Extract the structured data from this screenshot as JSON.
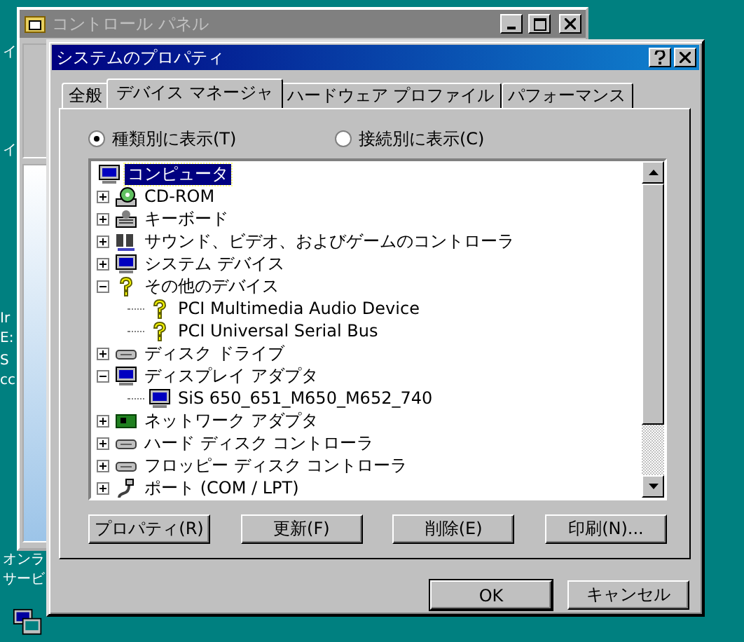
{
  "desktop_labels": [
    "イ",
    "イ",
    "Ir",
    "E:",
    "S",
    "cc",
    "オンラ",
    "サービ"
  ],
  "background_window": {
    "title": "コントロール パネル"
  },
  "dialog": {
    "title": "システムのプロパティ"
  },
  "tabs": [
    {
      "label": "全般",
      "selected": false
    },
    {
      "label": "デバイス マネージャ",
      "selected": true
    },
    {
      "label": "ハードウェア プロファイル",
      "selected": false
    },
    {
      "label": "パフォーマンス",
      "selected": false
    }
  ],
  "view_options": [
    {
      "label": "種類別に表示(T)",
      "selected": true
    },
    {
      "label": "接続別に表示(C)",
      "selected": false
    }
  ],
  "device_tree": {
    "label": "コンピュータ",
    "selected": true,
    "children": [
      {
        "label": "CD-ROM",
        "expanded": false
      },
      {
        "label": "キーボード",
        "expanded": false
      },
      {
        "label": "サウンド、ビデオ、およびゲームのコントローラ",
        "expanded": false
      },
      {
        "label": "システム デバイス",
        "expanded": false
      },
      {
        "label": "その他のデバイス",
        "expanded": true,
        "children": [
          {
            "label": "PCI Multimedia Audio Device"
          },
          {
            "label": "PCI Universal Serial Bus"
          }
        ]
      },
      {
        "label": "ディスク ドライブ",
        "expanded": false
      },
      {
        "label": "ディスプレイ アダプタ",
        "expanded": true,
        "children": [
          {
            "label": "SiS 650_651_M650_M652_740"
          }
        ]
      },
      {
        "label": "ネットワーク アダプタ",
        "expanded": false
      },
      {
        "label": "ハード ディスク コントローラ",
        "expanded": false
      },
      {
        "label": "フロッピー ディスク コントローラ",
        "expanded": false
      },
      {
        "label": "ポート (COM / LPT)",
        "expanded": false
      }
    ]
  },
  "panel_buttons": [
    "プロパティ(R)",
    "更新(F)",
    "削除(E)",
    "印刷(N)..."
  ],
  "dialog_buttons": [
    "OK",
    "キャンセル"
  ]
}
